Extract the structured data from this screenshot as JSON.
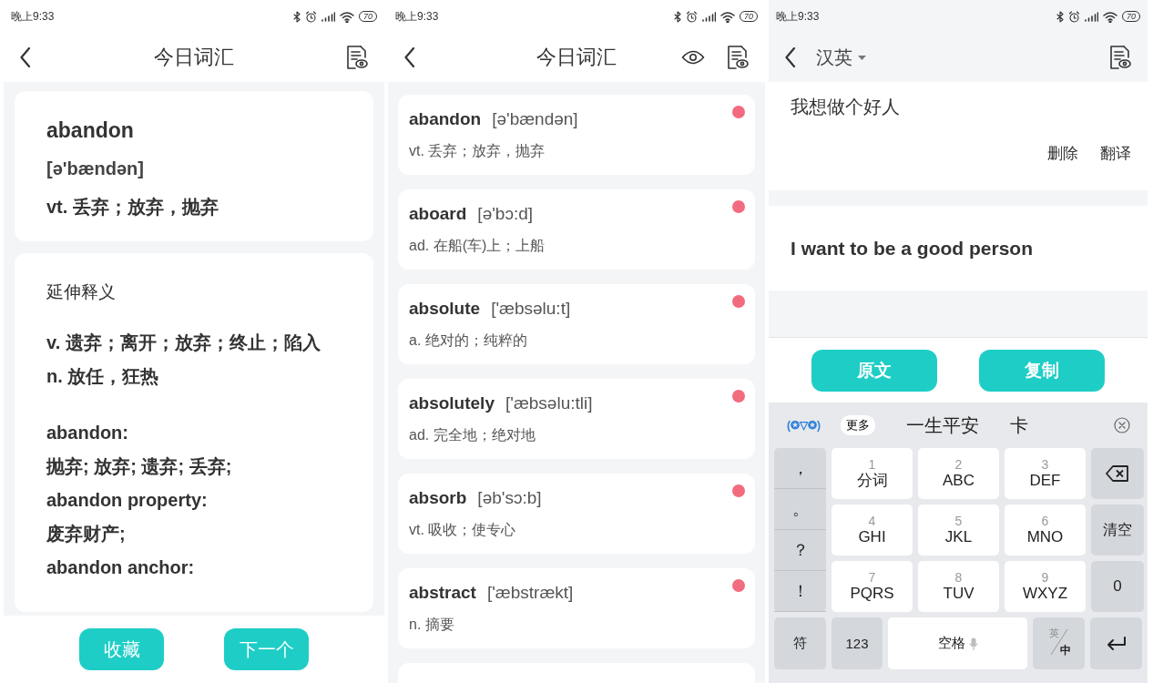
{
  "word_detail": {
    "status_bar": {
      "time": "晚上9:33",
      "battery": "70"
    },
    "header": {
      "title": "今日词汇"
    },
    "word_card": {
      "word": "abandon",
      "phonetic": "[ə'bændən]",
      "meaning": "vt. 丢弃；放弃，抛弃"
    },
    "detail_card": {
      "heading": "延伸释义",
      "definitions": [
        "v. 遗弃；离开；放弃；终止；陷入",
        "n. 放任，狂热"
      ],
      "phrases": [
        {
          "term": "abandon:",
          "meaning": "抛弃; 放弃; 遗弃; 丢弃;"
        },
        {
          "term": "abandon property:",
          "meaning": "废弃财产;"
        },
        {
          "term": "abandon anchor:"
        }
      ]
    },
    "buttons": [
      "收藏",
      "下一个"
    ]
  },
  "word_list": {
    "status_bar": {
      "time": "晚上9:33",
      "battery": "70"
    },
    "header": {
      "title": "今日词汇"
    },
    "items": [
      {
        "word": "abandon",
        "phonetic": "[ə'bændən]",
        "meaning": "vt. 丢弃；放弃，抛弃",
        "marked": true
      },
      {
        "word": "aboard",
        "phonetic": "[ə'bɔ:d]",
        "meaning": "ad. 在船(车)上；上船",
        "marked": true
      },
      {
        "word": "absolute",
        "phonetic": "['æbsəlu:t]",
        "meaning": "a. 绝对的；纯粹的",
        "marked": true
      },
      {
        "word": "absolutely",
        "phonetic": "['æbsəlu:tli]",
        "meaning": "ad. 完全地；绝对地",
        "marked": true
      },
      {
        "word": "absorb",
        "phonetic": "[əb'sɔ:b]",
        "meaning": "vt. 吸收；使专心",
        "marked": true
      },
      {
        "word": "abstract",
        "phonetic": "['æbstrækt]",
        "meaning": "n. 摘要",
        "marked": true
      }
    ]
  },
  "translator": {
    "status_bar": {
      "time": "晚上9:33",
      "battery": "70"
    },
    "header": {
      "language": "汉英"
    },
    "source_text": "我想做个好人",
    "actions": [
      "删除",
      "翻译"
    ],
    "result": "I want to be a good person",
    "buttons": [
      "原文",
      "复制"
    ],
    "keyboard": {
      "emoticon": "(✪▽✪)",
      "more": "更多",
      "candidates": [
        "一生平安",
        "卡"
      ],
      "symbols": [
        "，",
        "。",
        "？",
        "！"
      ],
      "keys": [
        {
          "digit": "1",
          "letters": "分词"
        },
        {
          "digit": "2",
          "letters": "ABC"
        },
        {
          "digit": "3",
          "letters": "DEF"
        },
        {
          "digit": "4",
          "letters": "GHI"
        },
        {
          "digit": "5",
          "letters": "JKL"
        },
        {
          "digit": "6",
          "letters": "MNO"
        },
        {
          "digit": "7",
          "letters": "PQRS"
        },
        {
          "digit": "8",
          "letters": "TUV"
        },
        {
          "digit": "9",
          "letters": "WXYZ"
        }
      ],
      "clear_key": "清空",
      "zero_key": "0",
      "symbol_key": "符",
      "number_key": "123",
      "space_key": "空格",
      "lang_key": {
        "top": "英",
        "bottom": "中"
      }
    }
  }
}
